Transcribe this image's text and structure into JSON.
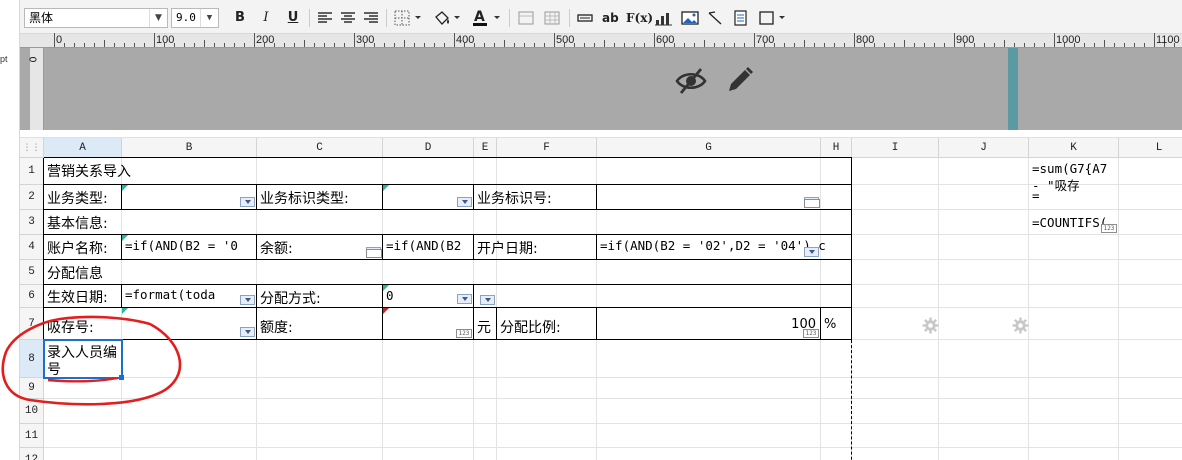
{
  "left_panel": {
    "unit_label": "pt"
  },
  "toolbar": {
    "font_family": "黑体",
    "font_size": "9.0",
    "bold_label": "B",
    "italic_label": "I",
    "underline_label": "U",
    "ab_label": "ab",
    "fx_label": "F(x)"
  },
  "ruler": {
    "labels": [
      "0",
      "100",
      "200",
      "300",
      "400",
      "500",
      "600",
      "700",
      "800",
      "900",
      "1000",
      "1100"
    ],
    "left_label": "0"
  },
  "columns": [
    "A",
    "B",
    "C",
    "D",
    "E",
    "F",
    "G",
    "H",
    "I",
    "J",
    "K",
    "L"
  ],
  "rows": [
    "1",
    "2",
    "3",
    "4",
    "5",
    "6",
    "7",
    "8",
    "9",
    "10",
    "11",
    "12"
  ],
  "cells": {
    "A1": "营销关系导入",
    "A2": "业务类型:",
    "C2": "业务标识类型:",
    "E2": "业务标识号:",
    "A3": "基本信息:",
    "A4": "账户名称:",
    "B4": "=if(AND(B2 = '0",
    "C4": "余额:",
    "D4": "=if(AND(B2",
    "E4": "开户日期:",
    "G4": "=if(AND(B2 = '02',D2 = '04').c",
    "A5": "分配信息",
    "A6": "生效日期:",
    "B6": "=format(toda",
    "C6": "分配方式:",
    "D6": "0",
    "A7": "吸存号:",
    "C7": "额度:",
    "E7": "元",
    "F7": "分配比例:",
    "G7": "100",
    "H7": "%",
    "A8_line1": "录入人员编",
    "A8_line2": "号",
    "K1_line1": "=sum(G7{A7",
    "K1_line2": "- \"吸存",
    "K2": "=",
    "K3": "=COUNTIFS("
  },
  "badges": {
    "num": "123"
  },
  "colors": {
    "accent": "#1a6fd1",
    "annotation": "#e31e1e",
    "ruler_bg": "#a9a9a9"
  }
}
